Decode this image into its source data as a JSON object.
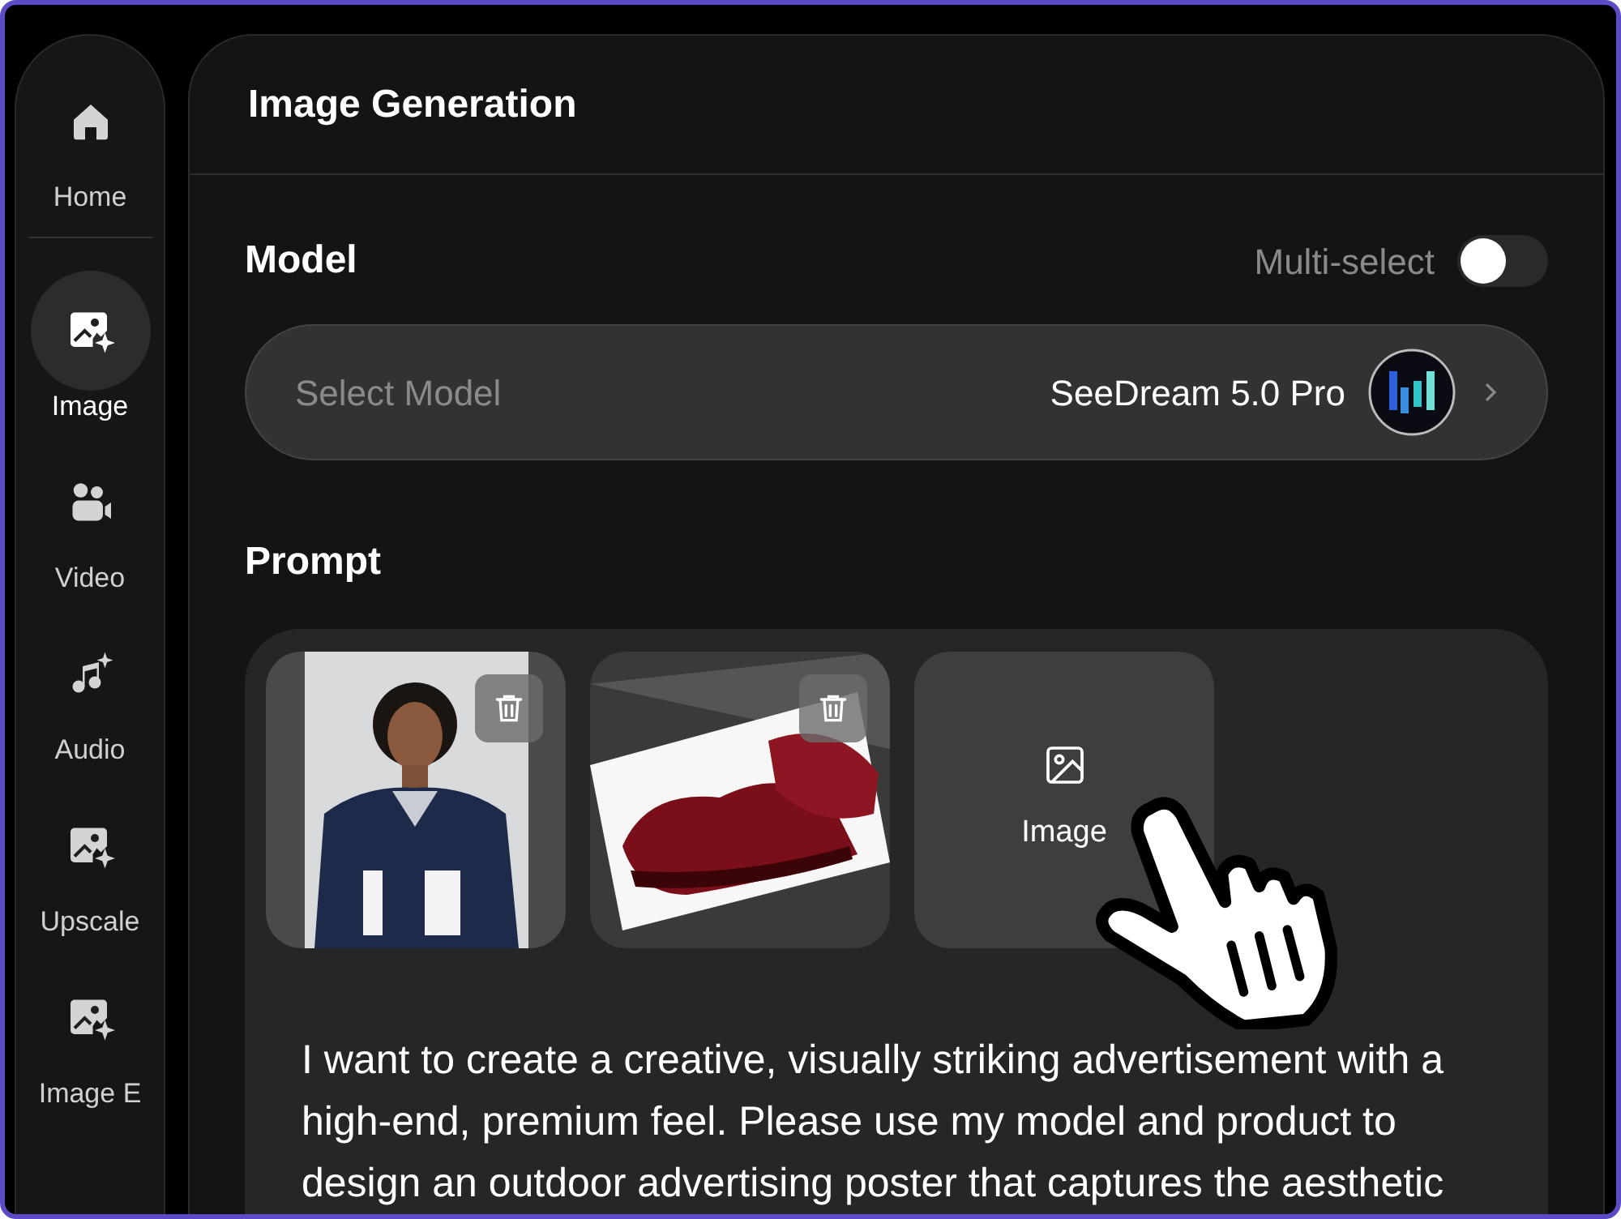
{
  "sidebar": {
    "items": [
      {
        "label": "Home",
        "selected": false
      },
      {
        "label": "Image",
        "selected": true
      },
      {
        "label": "Video",
        "selected": false
      },
      {
        "label": "Audio",
        "selected": false
      },
      {
        "label": "Upscale",
        "selected": false
      },
      {
        "label": "Image E",
        "selected": false
      }
    ]
  },
  "panel": {
    "title": "Image Generation"
  },
  "model": {
    "label": "Model",
    "multi_select": {
      "label": "Multi-select",
      "on": false
    },
    "select": {
      "label": "Select Model",
      "value": "SeeDream 5.0 Pro"
    }
  },
  "prompt": {
    "label": "Prompt",
    "attachments": [
      {
        "kind": "person"
      },
      {
        "kind": "product"
      },
      {
        "kind": "add",
        "label": "Image"
      }
    ],
    "text": "I want to create a creative, visually striking advertisement with a high-end, premium feel. Please use my model and product to design an outdoor advertising poster that captures the aesthetic"
  }
}
